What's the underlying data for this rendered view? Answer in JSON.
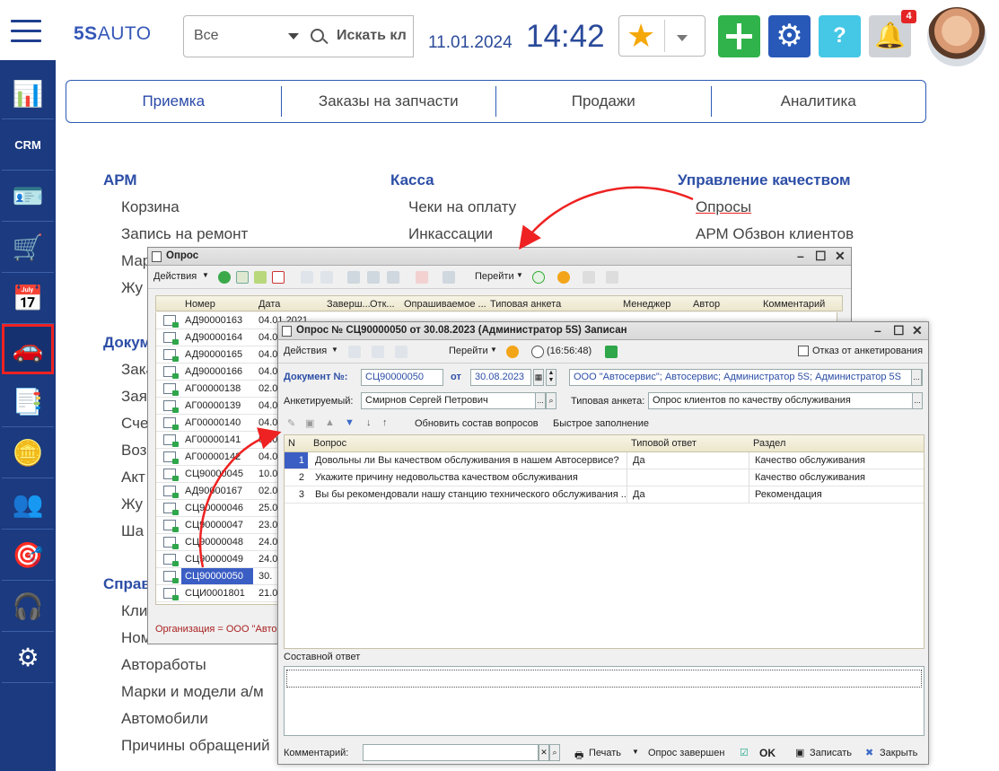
{
  "header": {
    "logo_brand": "5S",
    "logo_text": "AUTO",
    "filter_value": "Все",
    "search_placeholder": "Искать кл",
    "date": "11.01.2024",
    "time": "14:42",
    "notifications_count": "4"
  },
  "tabs": [
    "Приемка",
    "Заказы на запчасти",
    "Продажи",
    "Аналитика"
  ],
  "sidebar": [
    "analytics-icon",
    "crm-icon",
    "contacts-icon",
    "cart-icon",
    "calendar-icon",
    "car-lift-icon",
    "documents-icon",
    "coins-icon",
    "people-icon",
    "target-icon",
    "support-icon",
    "settings-icon"
  ],
  "menu": {
    "arm_title": "АРМ",
    "arm_items": [
      "Корзина",
      "Запись на ремонт",
      "Мар",
      "Жу"
    ],
    "kassa_title": "Касса",
    "kassa_items": [
      "Чеки на оплату",
      "Инкассации"
    ],
    "quality_title": "Управление качеством",
    "quality_items": [
      "Опросы",
      "АРМ Обзвон клиентов"
    ],
    "docs_title": "Докум",
    "docs_items": [
      "Зака",
      "Зая",
      "Сче",
      "Воз",
      "Акт",
      "Жу",
      "Ша"
    ],
    "refs_title": "Справ",
    "refs_items": [
      "Кли",
      "Ном",
      "Автоработы",
      "Марки и модели а/м",
      "Автомобили",
      "Причины обращений"
    ]
  },
  "list_window": {
    "title": "Опрос",
    "toolbar_actions": "Действия",
    "toolbar_goto": "Перейти",
    "columns": [
      "Номер",
      "Дата",
      "Заверш...",
      "Отк...",
      "Опрашиваемое ...",
      "Типовая анкета",
      "Менеджер",
      "Автор",
      "Комментарий"
    ],
    "rows": [
      {
        "num": "АД90000163",
        "date": "04.01.2021"
      },
      {
        "num": "АД90000164",
        "date": "04.0"
      },
      {
        "num": "АД90000165",
        "date": "04.0"
      },
      {
        "num": "АД90000166",
        "date": "04.0"
      },
      {
        "num": "АГ00000138",
        "date": "02.0"
      },
      {
        "num": "АГ00000139",
        "date": "04.0"
      },
      {
        "num": "АГ00000140",
        "date": "04.0"
      },
      {
        "num": "АГ00000141",
        "date": "04.0"
      },
      {
        "num": "АГ00000142",
        "date": "04.0"
      },
      {
        "num": "СЦ90000045",
        "date": "10.0"
      },
      {
        "num": "АД90000167",
        "date": "02.0"
      },
      {
        "num": "СЦ90000046",
        "date": "25.0"
      },
      {
        "num": "СЦ90000047",
        "date": "23.0"
      },
      {
        "num": "СЦ90000048",
        "date": "24.0"
      },
      {
        "num": "СЦ90000049",
        "date": "24.0"
      },
      {
        "num": "СЦ90000050",
        "date": "30."
      },
      {
        "num": "СЦИ0001801",
        "date": "21.0"
      }
    ],
    "status": "Организация = ООО \"Авто"
  },
  "form_window": {
    "title": "Опрос № СЦ90000050 от 30.08.2023 (Администратор 5S) Записан",
    "toolbar_actions": "Действия",
    "toolbar_goto": "Перейти",
    "toolbar_time": "(16:56:48)",
    "refuse_label": "Отказ от анкетирования",
    "doc_label": "Документ №:",
    "doc_number": "СЦ90000050",
    "from_label": "от",
    "doc_date": "30.08.2023",
    "org": "ООО \"Автосервис\"; Автосервис; Администратор 5S; Администратор 5S",
    "respondent_label": "Анкетируемый:",
    "respondent": "Смирнов Сергей Петрович",
    "template_label": "Типовая анкета:",
    "template": "Опрос клиентов по качеству обслуживания",
    "refresh_questions": "Обновить состав вопросов",
    "quick_fill": "Быстрое заполнение",
    "columns": [
      "N",
      "Вопрос",
      "Типовой ответ",
      "Раздел"
    ],
    "rows": [
      {
        "n": "1",
        "question": "Довольны ли Вы качеством обслуживания в нашем Автосервисе?",
        "answer": "Да",
        "section": "Качество обслуживания"
      },
      {
        "n": "2",
        "question": "Укажите причину недовольства качеством обслуживания",
        "answer": "",
        "section": "Качество обслуживания"
      },
      {
        "n": "3",
        "question": "Вы бы рекомендовали нашу станцию технического обслуживания ...",
        "answer": "Да",
        "section": "Рекомендация"
      }
    ],
    "composite_label": "Составной ответ",
    "comment_label": "Комментарий:",
    "print_label": "Печать",
    "done_label": "Опрос завершен",
    "ok_label": "OK",
    "save_label": "Записать",
    "close_label": "Закрыть"
  },
  "colors": {
    "brand": "#1b3a7f",
    "accent": "#2c4ea6",
    "highlight": "#e22222",
    "add": "#2fb34a"
  }
}
